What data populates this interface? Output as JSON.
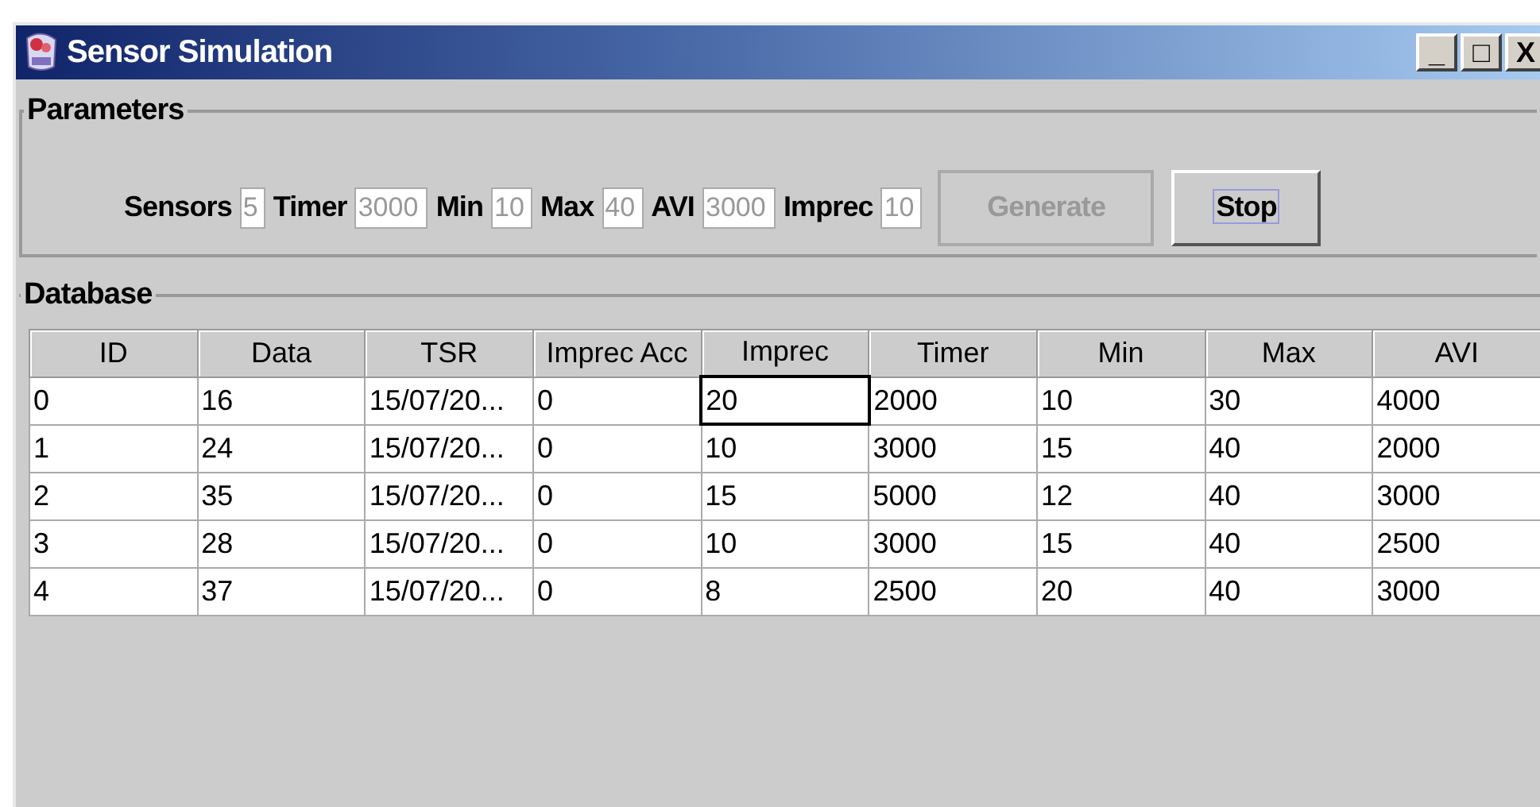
{
  "window": {
    "title": "Sensor Simulation",
    "controls": [
      "_",
      "□",
      "X"
    ]
  },
  "parameters": {
    "title": "Parameters",
    "fields": [
      {
        "label": "Sensors",
        "value": "5",
        "disabled": true
      },
      {
        "label": "Timer",
        "value": "3000",
        "disabled": true
      },
      {
        "label": "Min",
        "value": "10",
        "disabled": true
      },
      {
        "label": "Max",
        "value": "40",
        "disabled": true
      },
      {
        "label": "AVI",
        "value": "3000",
        "disabled": true
      },
      {
        "label": "Imprec",
        "value": "10",
        "disabled": true
      }
    ],
    "buttons": [
      {
        "label": "Generate",
        "disabled": true,
        "focused": false
      },
      {
        "label": "Stop",
        "disabled": false,
        "focused": true
      }
    ]
  },
  "database": {
    "title": "Database",
    "table": {
      "columns": [
        "ID",
        "Data",
        "TSR",
        "Imprec Acc",
        "Imprec",
        "Timer",
        "Min",
        "Max",
        "AVI"
      ],
      "rows": [
        [
          {
            "text": "0",
            "focused": false
          },
          {
            "text": "16",
            "focused": false
          },
          {
            "text": "15/07/20...",
            "focused": false
          },
          {
            "text": "0",
            "focused": false
          },
          {
            "text": "20",
            "focused": true
          },
          {
            "text": "2000",
            "focused": false
          },
          {
            "text": "10",
            "focused": false
          },
          {
            "text": "30",
            "focused": false
          },
          {
            "text": "4000",
            "focused": false
          }
        ],
        [
          {
            "text": "1",
            "focused": false
          },
          {
            "text": "24",
            "focused": false
          },
          {
            "text": "15/07/20...",
            "focused": false
          },
          {
            "text": "0",
            "focused": false
          },
          {
            "text": "10",
            "focused": false
          },
          {
            "text": "3000",
            "focused": false
          },
          {
            "text": "15",
            "focused": false
          },
          {
            "text": "40",
            "focused": false
          },
          {
            "text": "2000",
            "focused": false
          }
        ],
        [
          {
            "text": "2",
            "focused": false
          },
          {
            "text": "35",
            "focused": false
          },
          {
            "text": "15/07/20...",
            "focused": false
          },
          {
            "text": "0",
            "focused": false
          },
          {
            "text": "15",
            "focused": false
          },
          {
            "text": "5000",
            "focused": false
          },
          {
            "text": "12",
            "focused": false
          },
          {
            "text": "40",
            "focused": false
          },
          {
            "text": "3000",
            "focused": false
          }
        ],
        [
          {
            "text": "3",
            "focused": false
          },
          {
            "text": "28",
            "focused": false
          },
          {
            "text": "15/07/20...",
            "focused": false
          },
          {
            "text": "0",
            "focused": false
          },
          {
            "text": "10",
            "focused": false
          },
          {
            "text": "3000",
            "focused": false
          },
          {
            "text": "15",
            "focused": false
          },
          {
            "text": "40",
            "focused": false
          },
          {
            "text": "2500",
            "focused": false
          }
        ],
        [
          {
            "text": "4",
            "focused": false
          },
          {
            "text": "37",
            "focused": false
          },
          {
            "text": "15/07/20...",
            "focused": false
          },
          {
            "text": "0",
            "focused": false
          },
          {
            "text": "8",
            "focused": false
          },
          {
            "text": "2500",
            "focused": false
          },
          {
            "text": "20",
            "focused": false
          },
          {
            "text": "40",
            "focused": false
          },
          {
            "text": "3000",
            "focused": false
          }
        ]
      ]
    }
  }
}
